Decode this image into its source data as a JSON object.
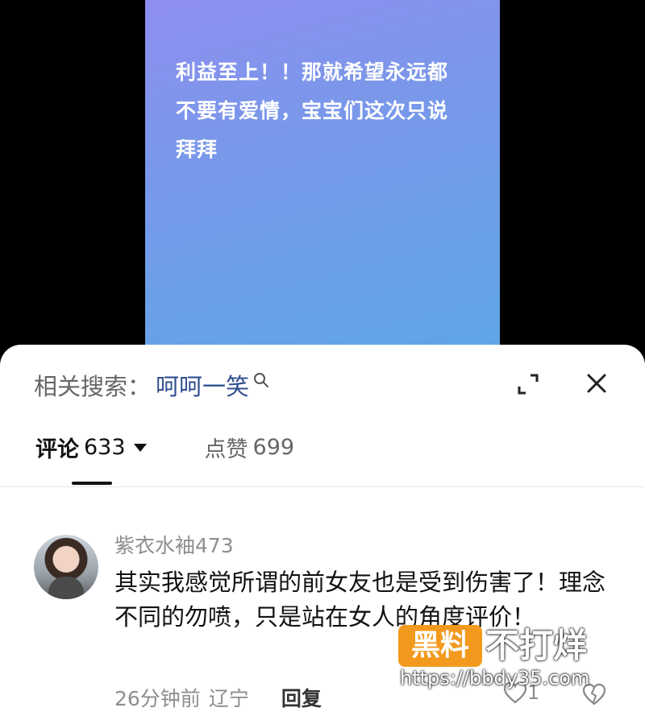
{
  "video": {
    "caption": "利益至上！！那就希望永远都不要有爱情，宝宝们这次只说拜拜"
  },
  "search": {
    "label": "相关搜索：",
    "term": "呵呵一笑"
  },
  "tabs": {
    "comments_label": "评论",
    "comments_count": "633",
    "likes_label": "点赞",
    "likes_count": "699"
  },
  "comments": [
    {
      "username": "紫衣水袖473",
      "text": "其实我感觉所谓的前女友也是受到伤害了！理念不同的勿喷，只是站在女人的角度评价！",
      "time": "26分钟前",
      "location": "辽宁",
      "reply_label": "回复",
      "like_count": "1"
    }
  ],
  "watermark": {
    "badge": "黑料",
    "title": "不打烊",
    "url": "https://bbdy35.com"
  },
  "icons": {
    "search": "search-icon",
    "expand": "expand-icon",
    "close": "close-icon",
    "caret": "caret-down-icon",
    "like": "heart-icon",
    "dislike": "broken-heart-icon"
  },
  "colors": {
    "search_term": "#2f4f8f",
    "watermark_badge": "#f39a1e"
  }
}
